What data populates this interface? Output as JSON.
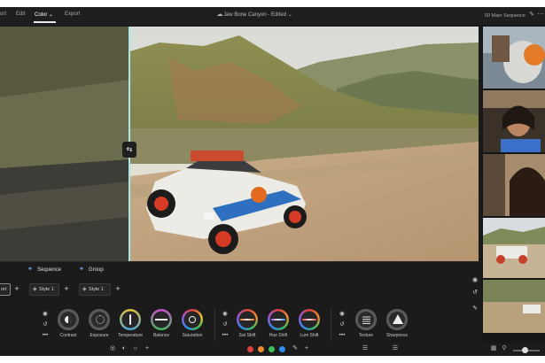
{
  "menu": {
    "items": [
      {
        "label": "ort"
      },
      {
        "label": "Edit"
      },
      {
        "label": "Color ⌄"
      },
      {
        "label": "Export"
      }
    ],
    "document_title": "Jaw Bone Canyon - Edited ⌄",
    "sequence_title": "00 Main Sequence"
  },
  "panel": {
    "tabs": [
      {
        "label": "Sequence"
      },
      {
        "label": "Group"
      }
    ],
    "chips": [
      {
        "label": "ort"
      },
      {
        "label": "Style 1"
      },
      {
        "label": "Style 1"
      }
    ],
    "knobs": [
      {
        "label": "Contrast"
      },
      {
        "label": "Exposure"
      },
      {
        "label": "Temperature"
      },
      {
        "label": "Balance"
      },
      {
        "label": "Saturation"
      },
      {
        "label": "Sat Shift"
      },
      {
        "label": "Hue Shift"
      },
      {
        "label": "Lum Shift"
      },
      {
        "label": "Texture"
      },
      {
        "label": "Sharpness"
      }
    ]
  },
  "colors": {
    "accent": "#7fb3ff",
    "split_line": "#a9e8ea",
    "swatches": [
      "#e0413a",
      "#f08a30",
      "#3fbf5a",
      "#2f8cf0",
      "#9a5ad8"
    ]
  },
  "icons": [
    "eye-icon",
    "undo-icon",
    "more-icon",
    "plus-icon",
    "split-handle-icon",
    "pencil-icon",
    "brush-icon",
    "eyedropper-icon",
    "gear-icon"
  ]
}
